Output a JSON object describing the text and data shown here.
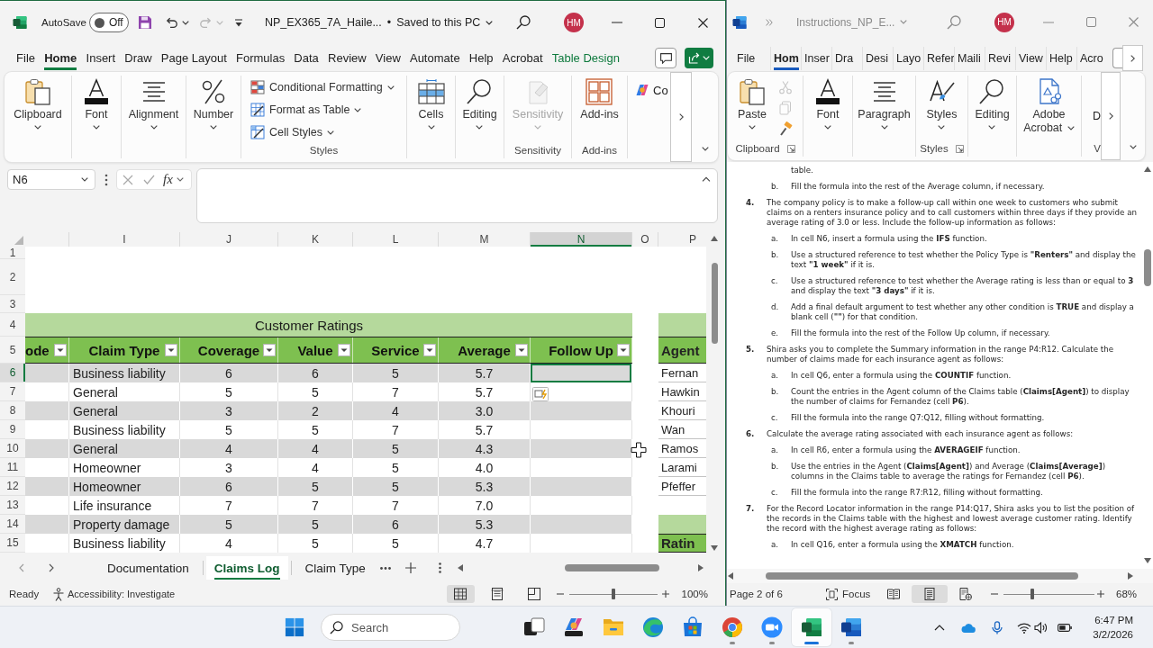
{
  "excel": {
    "title_bar": {
      "active": true,
      "autosave_label": "AutoSave",
      "autosave": {
        "on": false,
        "label": "Off"
      },
      "quick_access": [
        {
          "disabled": false
        },
        {
          "disabled": false
        },
        {
          "disabled": true
        }
      ],
      "document_title": "NP_EX365_7A_Haile...",
      "separator": "•",
      "save_status": "Saved to this PC",
      "avatar": "HM"
    },
    "menu_tabs": [
      {
        "label": "File",
        "selected": false,
        "kind": "standard"
      },
      {
        "label": "Home",
        "selected": true,
        "kind": "standard"
      },
      {
        "label": "Insert",
        "selected": false,
        "kind": "standard"
      },
      {
        "label": "Draw",
        "selected": false,
        "kind": "standard"
      },
      {
        "label": "Page Layout",
        "selected": false,
        "kind": "standard"
      },
      {
        "label": "Formulas",
        "selected": false,
        "kind": "standard"
      },
      {
        "label": "Data",
        "selected": false,
        "kind": "standard"
      },
      {
        "label": "Review",
        "selected": false,
        "kind": "standard"
      },
      {
        "label": "View",
        "selected": false,
        "kind": "standard"
      },
      {
        "label": "Automate",
        "selected": false,
        "kind": "standard"
      },
      {
        "label": "Help",
        "selected": false,
        "kind": "standard"
      },
      {
        "label": "Acrobat",
        "selected": false,
        "kind": "standard"
      },
      {
        "label": "Table Design",
        "selected": false,
        "kind": "contextual"
      }
    ],
    "ribbon": [
      {
        "kind": "large",
        "label": "Clipboard",
        "dropdown": true,
        "disabled": false
      },
      {
        "kind": "large",
        "label": "Font",
        "dropdown": true,
        "disabled": false
      },
      {
        "kind": "large",
        "label": "Alignment",
        "dropdown": true,
        "disabled": false
      },
      {
        "kind": "large",
        "label": "Number",
        "dropdown": true,
        "disabled": false
      },
      {
        "kind": "stack",
        "disabled": false,
        "group_label": "Styles",
        "items": [
          {
            "label": "Conditional Formatting",
            "dropdown": true
          },
          {
            "label": "Format as Table",
            "dropdown": true
          },
          {
            "label": "Cell Styles",
            "dropdown": true
          }
        ]
      },
      {
        "kind": "large",
        "label": "Cells",
        "dropdown": true,
        "disabled": false
      },
      {
        "kind": "large",
        "label": "Editing",
        "dropdown": true,
        "disabled": false
      },
      {
        "kind": "large",
        "label": "Sensitivity",
        "dropdown": true,
        "disabled": true,
        "group_label": "Sensitivity"
      },
      {
        "kind": "large",
        "label": "Add-ins",
        "dropdown": false,
        "disabled": false,
        "group_label": "Add-ins"
      },
      {
        "kind": "compact",
        "label": "Co",
        "dropdown": false,
        "disabled": false
      }
    ],
    "formula_bar": {
      "name_box": "N6",
      "function_label": "fx"
    },
    "grid": {
      "columns": [
        {
          "label": "I",
          "selected": false
        },
        {
          "label": "J",
          "selected": false
        },
        {
          "label": "K",
          "selected": false
        },
        {
          "label": "L",
          "selected": false
        },
        {
          "label": "M",
          "selected": false
        },
        {
          "label": "N",
          "selected": true
        },
        {
          "label": "O",
          "selected": false
        },
        {
          "label": "P",
          "selected": false
        }
      ],
      "rows": [
        {
          "row": "1",
          "kind": "blank",
          "selected": false
        },
        {
          "row": "2",
          "kind": "blank",
          "selected": false
        },
        {
          "row": "3",
          "kind": "blank",
          "selected": false
        },
        {
          "row": "4",
          "kind": "title",
          "selected": false,
          "text": "Customer Ratings",
          "side": {
            "kind": "band"
          }
        },
        {
          "row": "5",
          "kind": "header",
          "selected": false,
          "cells": [
            "ode",
            "Claim Type",
            "Coverage",
            "Value",
            "Service",
            "Average",
            "Follow Up"
          ],
          "side": {
            "kind": "header",
            "text": "Agent"
          }
        },
        {
          "row": "6",
          "kind": "data",
          "selected": true,
          "cells": [
            "Business liability",
            "6",
            "6",
            "5",
            "5.7"
          ],
          "side": {
            "kind": "cell",
            "text": "Fernan"
          }
        },
        {
          "row": "7",
          "kind": "data",
          "selected": false,
          "cells": [
            "General",
            "5",
            "5",
            "7",
            "5.7"
          ],
          "side": {
            "kind": "cell",
            "text": "Hawkin"
          }
        },
        {
          "row": "8",
          "kind": "data",
          "selected": false,
          "cells": [
            "General",
            "3",
            "2",
            "4",
            "3.0"
          ],
          "side": {
            "kind": "cell",
            "text": "Khouri"
          }
        },
        {
          "row": "9",
          "kind": "data",
          "selected": false,
          "cells": [
            "Business liability",
            "5",
            "5",
            "7",
            "5.7"
          ],
          "side": {
            "kind": "cell",
            "text": "Wan"
          }
        },
        {
          "row": "10",
          "kind": "data",
          "selected": false,
          "cells": [
            "General",
            "4",
            "4",
            "5",
            "4.3"
          ],
          "side": {
            "kind": "cell",
            "text": "Ramos"
          }
        },
        {
          "row": "11",
          "kind": "data",
          "selected": false,
          "cells": [
            "Homeowner",
            "3",
            "4",
            "5",
            "4.0"
          ],
          "side": {
            "kind": "cell",
            "text": "Larami"
          }
        },
        {
          "row": "12",
          "kind": "data",
          "selected": false,
          "cells": [
            "Homeowner",
            "6",
            "5",
            "5",
            "5.3"
          ],
          "side": {
            "kind": "cell",
            "text": "Pfeffer"
          }
        },
        {
          "row": "13",
          "kind": "data",
          "selected": false,
          "cells": [
            "Life insurance",
            "7",
            "7",
            "7",
            "7.0"
          ]
        },
        {
          "row": "14",
          "kind": "data",
          "selected": false,
          "cells": [
            "Property damage",
            "5",
            "5",
            "6",
            "5.3"
          ],
          "side": {
            "kind": "band"
          }
        },
        {
          "row": "15",
          "kind": "data",
          "selected": false,
          "cells": [
            "Business liability",
            "4",
            "5",
            "5",
            "4.7"
          ],
          "side": {
            "kind": "header",
            "text": "Ratin"
          }
        }
      ]
    },
    "sheet_tabs": [
      {
        "label": "Documentation",
        "selected": false
      },
      {
        "label": "Claims Log",
        "selected": true
      },
      {
        "label": "Claim Type",
        "selected": false
      }
    ],
    "status_bar": {
      "status": "Ready",
      "accessibility": "Accessibility: Investigate",
      "views": [
        {
          "selected": true
        },
        {
          "selected": false
        },
        {
          "selected": false
        }
      ],
      "zoom": {
        "level": 0.5,
        "reading": "100%"
      }
    }
  },
  "word": {
    "title_bar": {
      "active": false,
      "document_title": "Instructions_NP_E...",
      "avatar": "HM"
    },
    "menu_tabs": [
      {
        "label": "File",
        "selected": false
      },
      {
        "label": "Hom",
        "selected": true
      },
      {
        "label": "Inser",
        "selected": false
      },
      {
        "label": "Dra",
        "selected": false
      },
      {
        "label": "Desi",
        "selected": false
      },
      {
        "label": "Layo",
        "selected": false
      },
      {
        "label": "Refer",
        "selected": false
      },
      {
        "label": "Maili",
        "selected": false
      },
      {
        "label": "Revi",
        "selected": false
      },
      {
        "label": "View",
        "selected": false
      },
      {
        "label": "Help",
        "selected": false
      },
      {
        "label": "Acro",
        "selected": false
      }
    ],
    "ribbon": [
      {
        "kind": "large",
        "label": "Paste",
        "dropdown": true,
        "group_label": "Clipboard",
        "dialog_launcher": true,
        "tools": [
          {
            "disabled": true
          },
          {
            "disabled": true
          },
          {
            "disabled": false
          }
        ]
      },
      {
        "kind": "large",
        "label": "Font",
        "dropdown": true,
        "dialog_launcher": false
      },
      {
        "kind": "large",
        "label": "Paragraph",
        "dropdown": true,
        "dialog_launcher": false
      },
      {
        "kind": "large",
        "label": "Styles",
        "dropdown": true,
        "group_label": "Styles",
        "dialog_launcher": true
      },
      {
        "kind": "large",
        "label": "Editing",
        "dropdown": true,
        "dialog_launcher": false
      },
      {
        "kind": "wrapped",
        "label": "Adobe Acrobat",
        "dropdown": true,
        "dialog_launcher": false
      },
      {
        "kind": "partial",
        "label": "D",
        "group_label": "V",
        "dialog_launcher": false
      }
    ],
    "document": [
      {
        "children": [
          {
            "text": "table."
          },
          {
            "marker": "b.",
            "text": "Fill the formula into the rest of the Average column, if necessary."
          }
        ]
      },
      {
        "marker": "4.",
        "text": "The company policy is to make a follow-up call within one week to customers who submit claims on a renters insurance policy and to call customers within three days if they provide an average rating of 3.0 or less. Include the follow-up information as follows:",
        "children": [
          {
            "marker": "a.",
            "text": "In cell N6, insert a formula using the **IFS** function."
          },
          {
            "marker": "b.",
            "text": "Use a structured reference to test whether the Policy Type is **\"Renters\"** and display the text **\"1 week\"** if it is."
          },
          {
            "marker": "c.",
            "text": "Use a structured reference to test whether the Average rating is less than or equal to **3** and display the text **\"3 days\"** if it is."
          },
          {
            "marker": "d.",
            "text": "Add a final default argument to test whether any other condition is **TRUE** and display a blank cell (**\"\"**) for that condition."
          },
          {
            "marker": "e.",
            "text": "Fill the formula into the rest of the Follow Up column, if necessary."
          }
        ]
      },
      {
        "marker": "5.",
        "text": "Shira asks you to complete the Summary information in the range P4:R12. Calculate the number of claims made for each insurance agent as follows:",
        "children": [
          {
            "marker": "a.",
            "text": "In cell Q6, enter a formula using the **COUNTIF** function."
          },
          {
            "marker": "b.",
            "text": "Count the entries in the Agent column of the Claims table (**Claims[Agent]**) to display the number of claims for Fernandez (cell **P6**)."
          },
          {
            "marker": "c.",
            "text": "Fill the formula into the range Q7:Q12, filling without formatting."
          }
        ]
      },
      {
        "marker": "6.",
        "text": "Calculate the average rating associated with each insurance agent as follows:",
        "children": [
          {
            "marker": "a.",
            "text": "In cell R6, enter a formula using the **AVERAGEIF** function."
          },
          {
            "marker": "b.",
            "text": "Use the entries in the Agent (**Claims[Agent]**) and Average (**Claims[Average]**) columns in the Claims table to average the ratings for Fernandez (cell **P6**)."
          },
          {
            "marker": "c.",
            "text": "Fill the formula into the range R7:R12, filling without formatting."
          }
        ]
      },
      {
        "marker": "7.",
        "text": "For the Record Locator information in the range P14:Q17, Shira asks you to list the position of the records in the Claims table with the highest and lowest average customer rating. Identify the record with the highest average rating as follows:",
        "children": [
          {
            "marker": "a.",
            "text": "In cell Q16, enter a formula using the **XMATCH** function."
          }
        ]
      }
    ],
    "status_bar": {
      "page": "Page 2 of 6",
      "focus": "Focus",
      "views": [
        {
          "selected": false
        },
        {
          "selected": true
        },
        {
          "selected": false
        }
      ],
      "zoom": {
        "level": 0.32,
        "reading": "68%"
      }
    }
  },
  "taskbar": {
    "search": {
      "placeholder": "Search"
    },
    "apps": [
      {
        "running": false,
        "selected": false
      },
      {
        "running": false,
        "selected": false
      },
      {
        "running": false,
        "selected": false
      },
      {
        "running": false,
        "selected": false
      },
      {
        "running": false,
        "selected": false
      },
      {
        "running": true,
        "selected": false
      },
      {
        "running": true,
        "selected": false
      },
      {
        "running": true,
        "selected": true
      },
      {
        "running": true,
        "selected": false
      }
    ],
    "time": "6:47 PM",
    "date": "3/2/2026"
  }
}
